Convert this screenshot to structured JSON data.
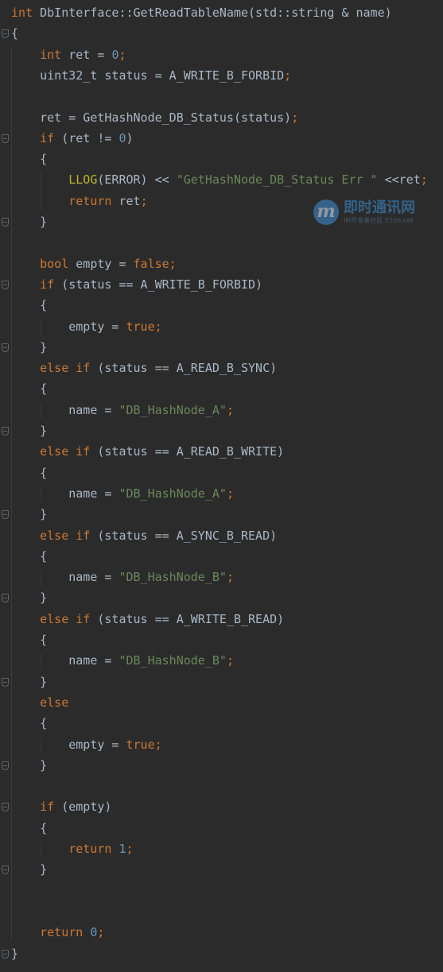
{
  "theme": {
    "background": "#2b2b2b",
    "plain": "#a9b7c6",
    "keyword": "#cc7832",
    "number": "#6897bb",
    "string": "#6a8759",
    "macro": "#bbb529",
    "guide": "#3b3b3b",
    "fold_marker": "#5f6366"
  },
  "code": {
    "lines": [
      [
        [
          "kw",
          "int"
        ],
        [
          "p",
          " DbInterface::GetReadTableName(std::string & name)"
        ]
      ],
      [
        [
          "p",
          "{"
        ]
      ],
      [
        [
          "p",
          "    "
        ],
        [
          "kw",
          "int"
        ],
        [
          "p",
          " ret = "
        ],
        [
          "num",
          "0"
        ],
        [
          "kw",
          ";"
        ]
      ],
      [
        [
          "p",
          "    uint32_t status = A_WRITE_B_FORBID"
        ],
        [
          "kw",
          ";"
        ]
      ],
      [],
      [
        [
          "p",
          "    ret = GetHashNode_DB_Status(status)"
        ],
        [
          "kw",
          ";"
        ]
      ],
      [
        [
          "p",
          "    "
        ],
        [
          "kw",
          "if"
        ],
        [
          "p",
          " (ret != "
        ],
        [
          "num",
          "0"
        ],
        [
          "p",
          ")"
        ]
      ],
      [
        [
          "p",
          "    {"
        ]
      ],
      [
        [
          "p",
          "        "
        ],
        [
          "fn",
          "LLOG"
        ],
        [
          "p",
          "(ERROR) << "
        ],
        [
          "str",
          "\"GetHashNode_DB_Status Err \""
        ],
        [
          "p",
          " <<ret"
        ],
        [
          "kw",
          ";"
        ]
      ],
      [
        [
          "p",
          "        "
        ],
        [
          "kw",
          "return"
        ],
        [
          "p",
          " ret"
        ],
        [
          "kw",
          ";"
        ]
      ],
      [
        [
          "p",
          "    }"
        ]
      ],
      [],
      [
        [
          "p",
          "    "
        ],
        [
          "kw",
          "bool"
        ],
        [
          "p",
          " empty = "
        ],
        [
          "kw",
          "false;"
        ]
      ],
      [
        [
          "p",
          "    "
        ],
        [
          "kw",
          "if"
        ],
        [
          "p",
          " (status == A_WRITE_B_FORBID)"
        ]
      ],
      [
        [
          "p",
          "    {"
        ]
      ],
      [
        [
          "p",
          "        empty = "
        ],
        [
          "kw",
          "true;"
        ]
      ],
      [
        [
          "p",
          "    }"
        ]
      ],
      [
        [
          "p",
          "    "
        ],
        [
          "kw",
          "else if"
        ],
        [
          "p",
          " (status == A_READ_B_SYNC)"
        ]
      ],
      [
        [
          "p",
          "    {"
        ]
      ],
      [
        [
          "p",
          "        name = "
        ],
        [
          "str",
          "\"DB_HashNode_A\""
        ],
        [
          "kw",
          ";"
        ]
      ],
      [
        [
          "p",
          "    }"
        ]
      ],
      [
        [
          "p",
          "    "
        ],
        [
          "kw",
          "else if"
        ],
        [
          "p",
          " (status == A_READ_B_WRITE)"
        ]
      ],
      [
        [
          "p",
          "    {"
        ]
      ],
      [
        [
          "p",
          "        name = "
        ],
        [
          "str",
          "\"DB_HashNode_A\""
        ],
        [
          "kw",
          ";"
        ]
      ],
      [
        [
          "p",
          "    }"
        ]
      ],
      [
        [
          "p",
          "    "
        ],
        [
          "kw",
          "else if"
        ],
        [
          "p",
          " (status == A_SYNC_B_READ)"
        ]
      ],
      [
        [
          "p",
          "    {"
        ]
      ],
      [
        [
          "p",
          "        name = "
        ],
        [
          "str",
          "\"DB_HashNode_B\""
        ],
        [
          "kw",
          ";"
        ]
      ],
      [
        [
          "p",
          "    }"
        ]
      ],
      [
        [
          "p",
          "    "
        ],
        [
          "kw",
          "else if"
        ],
        [
          "p",
          " (status == A_WRITE_B_READ)"
        ]
      ],
      [
        [
          "p",
          "    {"
        ]
      ],
      [
        [
          "p",
          "        name = "
        ],
        [
          "str",
          "\"DB_HashNode_B\""
        ],
        [
          "kw",
          ";"
        ]
      ],
      [
        [
          "p",
          "    }"
        ]
      ],
      [
        [
          "p",
          "    "
        ],
        [
          "kw",
          "else"
        ]
      ],
      [
        [
          "p",
          "    {"
        ]
      ],
      [
        [
          "p",
          "        empty = "
        ],
        [
          "kw",
          "true;"
        ]
      ],
      [
        [
          "p",
          "    }"
        ]
      ],
      [],
      [
        [
          "p",
          "    "
        ],
        [
          "kw",
          "if"
        ],
        [
          "p",
          " (empty)"
        ]
      ],
      [
        [
          "p",
          "    {"
        ]
      ],
      [
        [
          "p",
          "        "
        ],
        [
          "kw",
          "return"
        ],
        [
          "p",
          " "
        ],
        [
          "num",
          "1"
        ],
        [
          "kw",
          ";"
        ]
      ],
      [
        [
          "p",
          "    }"
        ]
      ],
      [],
      [],
      [
        [
          "p",
          "    "
        ],
        [
          "kw",
          "return"
        ],
        [
          "p",
          " "
        ],
        [
          "num",
          "0"
        ],
        [
          "kw",
          ";"
        ]
      ],
      [
        [
          "p",
          "}"
        ]
      ]
    ]
  },
  "watermark": {
    "logo_glyph": "m",
    "title": "即时通讯网",
    "subtitle": "IM开发者社区  52im.net"
  }
}
